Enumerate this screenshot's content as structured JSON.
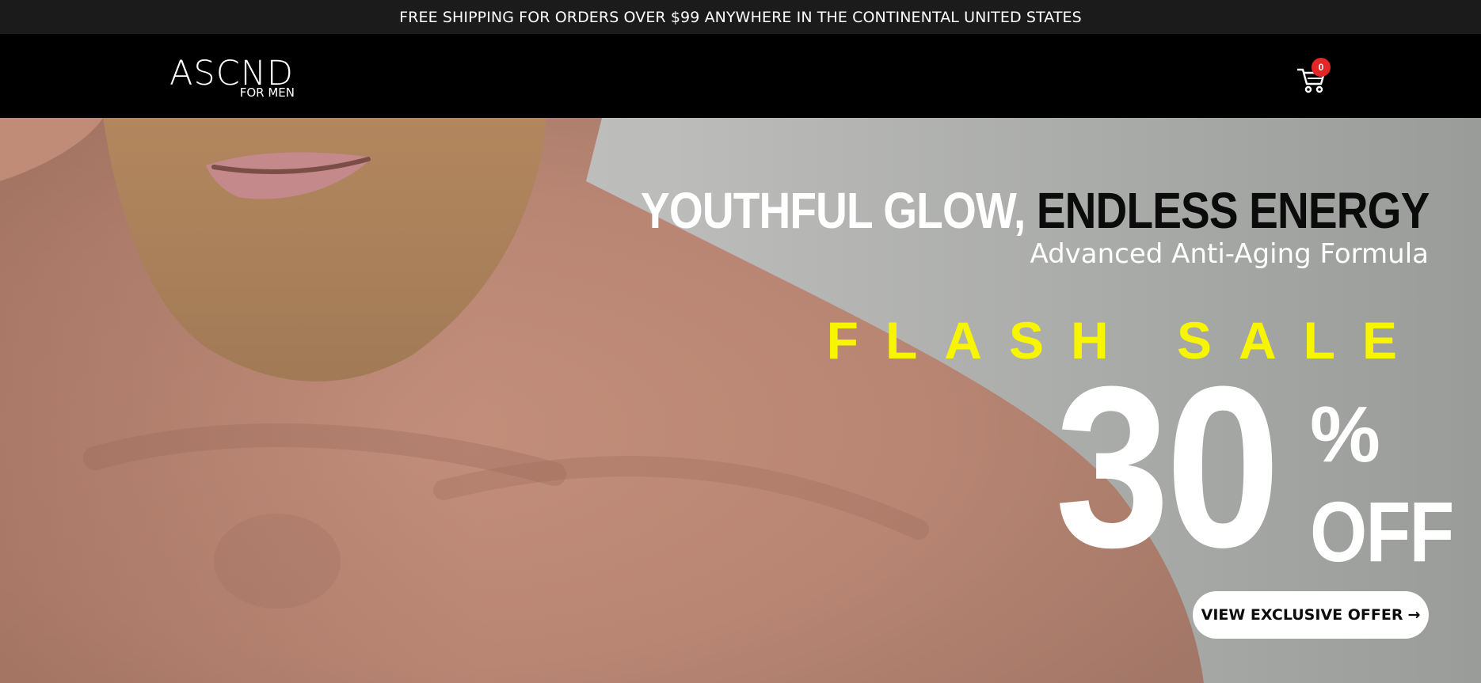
{
  "announcement": {
    "text": "FREE SHIPPING FOR ORDERS OVER $99 ANYWHERE IN THE CONTINENTAL UNITED STATES"
  },
  "header": {
    "logo_text": "ASCND",
    "logo_subtext": "FOR MEN",
    "cart_count": "0",
    "cart_icon": "shopping-cart-icon"
  },
  "hero": {
    "headline_part1": "YOUTHFUL GLOW,",
    "headline_part2": "ENDLESS ENERGY",
    "subheadline": "Advanced Anti-Aging Formula",
    "flash_label": "FLASH SALE",
    "discount_number": "30",
    "discount_percent": "%",
    "discount_off": "OFF",
    "cta_label": "VIEW EXCLUSIVE OFFER",
    "cta_arrow": "→"
  },
  "colors": {
    "announcement_bg": "#1b1b1b",
    "header_bg": "#000000",
    "accent_yellow": "#f8f500",
    "badge_red": "#e32626"
  }
}
